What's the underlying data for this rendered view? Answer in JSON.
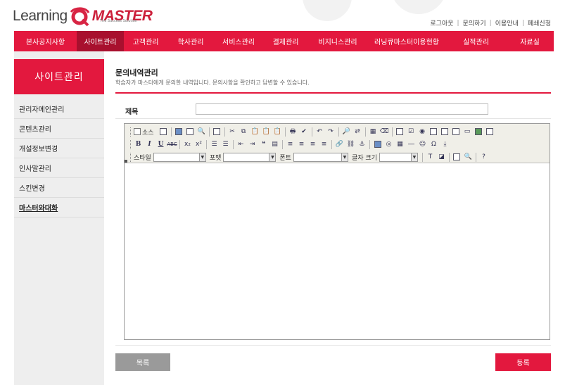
{
  "brand": {
    "name_prefix": "Learning",
    "name_suffix": "MASTER",
    "tagline": "The Success Solution",
    "accent_color": "#e3183e",
    "active_color": "#a8102e"
  },
  "top_links": [
    "로그아웃",
    "문의하기",
    "이용안내",
    "페쇄신청"
  ],
  "nav": {
    "items": [
      {
        "label": "본사공지사항",
        "active": false
      },
      {
        "label": "사이트관리",
        "active": true
      },
      {
        "label": "고객관리",
        "active": false
      },
      {
        "label": "학사관리",
        "active": false
      },
      {
        "label": "서비스관리",
        "active": false
      },
      {
        "label": "결제관리",
        "active": false
      },
      {
        "label": "비지니스관리",
        "active": false
      },
      {
        "label": "러닝큐마스터이용현황",
        "active": false
      },
      {
        "label": "실적관리",
        "active": false
      },
      {
        "label": "자료실",
        "active": false
      }
    ]
  },
  "sidebar": {
    "title": "사이트관리",
    "items": [
      {
        "label": "관리자메인관리",
        "active": false
      },
      {
        "label": "콘텐츠관리",
        "active": false
      },
      {
        "label": "개설정보변경",
        "active": false
      },
      {
        "label": "인사말관리",
        "active": false
      },
      {
        "label": "스킨변경",
        "active": false
      },
      {
        "label": "마스터와대화",
        "active": true
      }
    ]
  },
  "main": {
    "title": "문의내역관리",
    "description": "학습자가 마스터에게 문의한 내역입니다. 문의사항을 확인하고 답변할 수 있습니다.",
    "subject_label": "제목",
    "subject_value": "",
    "editor": {
      "source_label": "소스",
      "style_label": "스타일",
      "format_label": "포맷",
      "font_label": "폰트",
      "size_label": "글자 크기",
      "content": ""
    },
    "list_button": "목록",
    "submit_button": "등록"
  }
}
